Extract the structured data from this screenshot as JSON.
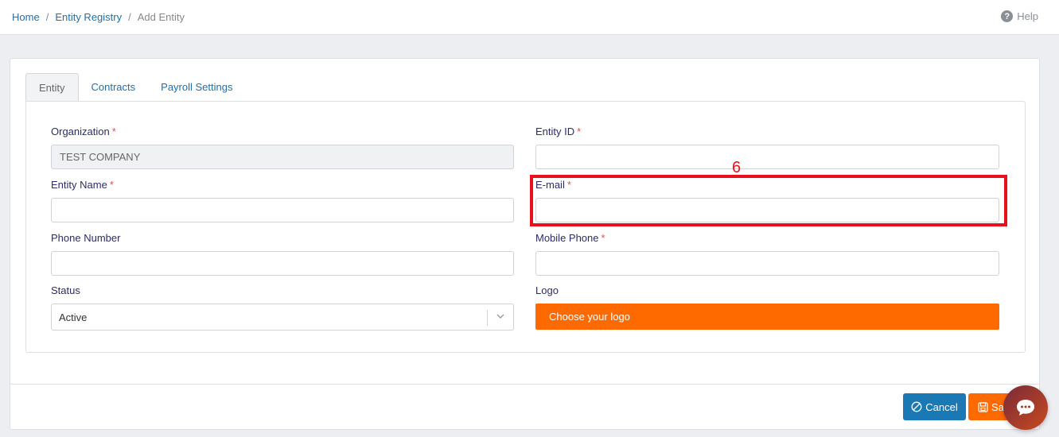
{
  "breadcrumb": {
    "home": "Home",
    "sep1": "/",
    "registry": "Entity Registry",
    "sep2": "/",
    "current": "Add Entity"
  },
  "help": {
    "label": "Help",
    "icon": "?"
  },
  "tabs": [
    {
      "label": "Entity"
    },
    {
      "label": "Contracts"
    },
    {
      "label": "Payroll Settings"
    }
  ],
  "form": {
    "required_mark": "*",
    "organization": {
      "label": "Organization",
      "value": "TEST COMPANY"
    },
    "entity_id": {
      "label": "Entity ID",
      "value": ""
    },
    "entity_name": {
      "label": "Entity Name",
      "value": ""
    },
    "email": {
      "label": "E-mail",
      "value": ""
    },
    "phone": {
      "label": "Phone Number",
      "value": ""
    },
    "mobile": {
      "label": "Mobile Phone",
      "value": ""
    },
    "status": {
      "label": "Status",
      "value": "Active"
    },
    "logo": {
      "label": "Logo",
      "button": "Choose your logo"
    }
  },
  "annotation": {
    "number": "6"
  },
  "actions": {
    "cancel": "Cancel",
    "save": "Sa"
  },
  "colors": {
    "accent": "#ff6a00",
    "primary": "#1a78b4",
    "highlight": "#e8101a"
  }
}
